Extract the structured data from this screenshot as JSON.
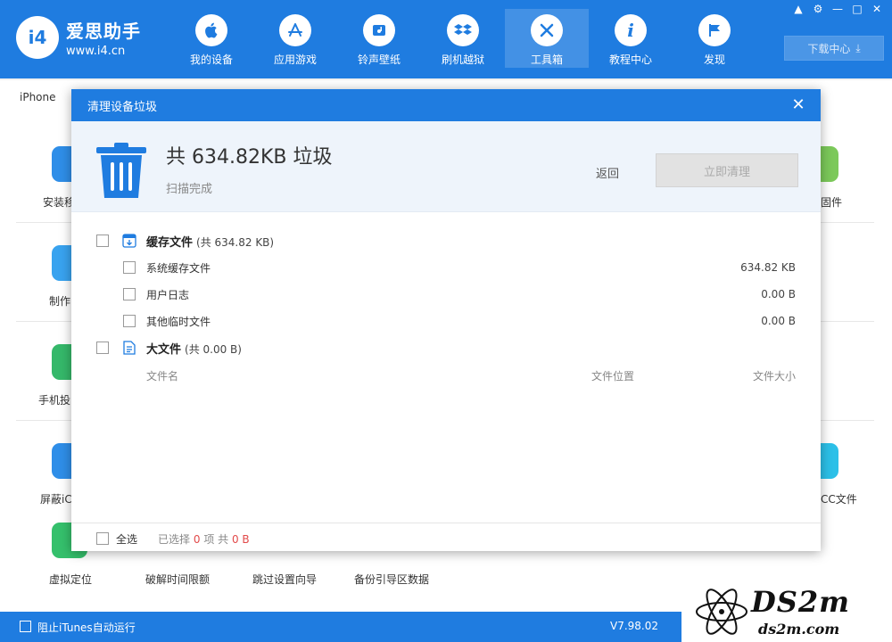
{
  "app": {
    "name": "爱思助手",
    "url": "www.i4.cn",
    "logo_badge": "i4"
  },
  "nav": [
    {
      "label": "我的设备",
      "icon": "apple-icon"
    },
    {
      "label": "应用游戏",
      "icon": "app-store-icon"
    },
    {
      "label": "铃声壁纸",
      "icon": "music-icon"
    },
    {
      "label": "刷机越狱",
      "icon": "dropbox-icon"
    },
    {
      "label": "工具箱",
      "icon": "tools-icon",
      "active": true
    },
    {
      "label": "教程中心",
      "icon": "info-icon"
    },
    {
      "label": "发现",
      "icon": "flag-icon"
    }
  ],
  "download_center": "下载中心",
  "device_tab": "iPhone",
  "background_labels": [
    "安装移",
    "制作",
    "手机投",
    "屏蔽iC",
    "虚拟定位",
    "破解时间限额",
    "跳过设置向导",
    "备份引导区数据",
    "固件",
    "CC文件"
  ],
  "status_bar": {
    "itunes_label": "阻止iTunes自动运行",
    "version": "V7.98.02"
  },
  "watermark": {
    "big": "DS2m",
    "small": "ds2m.com"
  },
  "modal": {
    "title": "清理设备垃圾",
    "total": "共 634.82KB 垃圾",
    "scan_status": "扫描完成",
    "back": "返回",
    "clean_now": "立即清理",
    "cache_category": {
      "label": "缓存文件",
      "sub": "(共 634.82 KB)"
    },
    "cache_items": [
      {
        "label": "系统缓存文件",
        "size": "634.82 KB"
      },
      {
        "label": "用户日志",
        "size": "0.00 B"
      },
      {
        "label": "其他临时文件",
        "size": "0.00 B"
      }
    ],
    "large_category": {
      "label": "大文件",
      "sub": "(共 0.00 B)"
    },
    "columns": {
      "name": "文件名",
      "location": "文件位置",
      "size": "文件大小"
    },
    "footer": {
      "select_all": "全选",
      "selected_prefix": "已选择",
      "selected_count": "0",
      "selected_mid": "项 共",
      "selected_size": "0 B"
    }
  },
  "colors": {
    "brand": "#1f7ce0",
    "highlight_red": "#e24a4a"
  }
}
